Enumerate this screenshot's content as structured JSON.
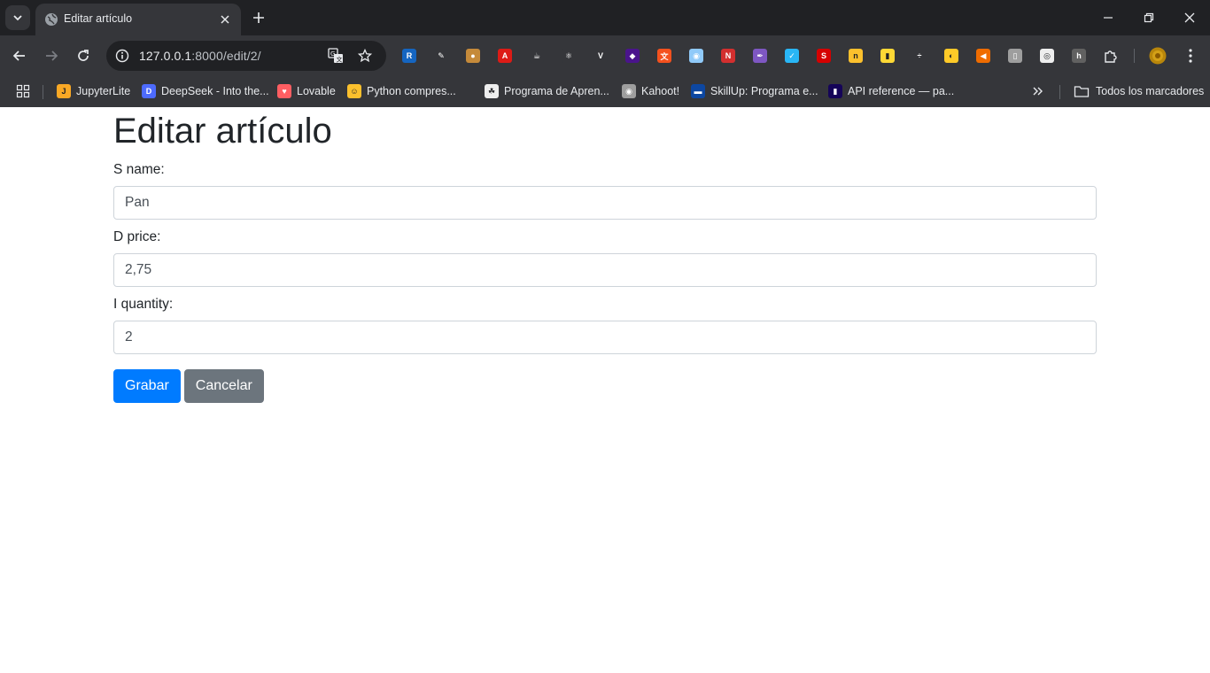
{
  "browser": {
    "tab": {
      "title": "Editar artículo"
    },
    "address": {
      "host": "127.0.0.1",
      "rest": ":8000/edit/2/"
    },
    "extensions": [
      {
        "icon": "react-dev-icon",
        "color": "#1565c0",
        "glyph": "R"
      },
      {
        "icon": "eyedropper-icon",
        "color": "#35363a",
        "glyph": "✎"
      },
      {
        "icon": "cookie-icon",
        "color": "#c58a3a",
        "glyph": "●"
      },
      {
        "icon": "angular-icon",
        "color": "#dd1b16",
        "glyph": "A"
      },
      {
        "icon": "java-icon",
        "color": "#35363a",
        "glyph": "☕"
      },
      {
        "icon": "react-icon",
        "color": "#35363a",
        "glyph": "⚛"
      },
      {
        "icon": "vue-icon",
        "color": "#35363a",
        "glyph": "V"
      },
      {
        "icon": "layers-icon",
        "color": "#4a148c",
        "glyph": "◆"
      },
      {
        "icon": "translate-ext-icon",
        "color": "#f4511e",
        "glyph": "文"
      },
      {
        "icon": "circle-ext-icon",
        "color": "#90caf9",
        "glyph": "◉"
      },
      {
        "icon": "new-ext-icon",
        "color": "#d32f2f",
        "glyph": "N"
      },
      {
        "icon": "feather-icon",
        "color": "#7e57c2",
        "glyph": "✒"
      },
      {
        "icon": "check-ext-icon",
        "color": "#29b6f6",
        "glyph": "✓"
      },
      {
        "icon": "s-ext-icon",
        "color": "#d50000",
        "glyph": "S"
      },
      {
        "icon": "n-ext-icon",
        "color": "#fbc02d",
        "glyph": "n"
      },
      {
        "icon": "bars-ext-icon",
        "color": "#fdd835",
        "glyph": "▮"
      },
      {
        "icon": "divider-ext-icon",
        "color": "#35363a",
        "glyph": "÷"
      },
      {
        "icon": "face-ext-icon",
        "color": "#ffca28",
        "glyph": "◐"
      },
      {
        "icon": "speaker-ext-icon",
        "color": "#ef6c00",
        "glyph": "◀"
      },
      {
        "icon": "mouse-ext-icon",
        "color": "#9e9e9e",
        "glyph": "▯"
      },
      {
        "icon": "doc-ext-icon",
        "color": "#eeeeee",
        "glyph": "◎"
      },
      {
        "icon": "h-ext-icon",
        "color": "#616161",
        "glyph": "h"
      }
    ],
    "bookmarks": [
      {
        "label": "JupyterLite",
        "icon": "jupyter-icon",
        "color": "#f9a825",
        "glyph": "J"
      },
      {
        "label": "DeepSeek - Into the...",
        "icon": "deepseek-icon",
        "color": "#4d6bfe",
        "glyph": "D"
      },
      {
        "label": "Lovable",
        "icon": "heart-icon",
        "color": "#ff5e62",
        "glyph": "♥"
      },
      {
        "label": "Python compres...",
        "icon": "python-icon",
        "color": "#fbc02d",
        "glyph": "☺"
      },
      {
        "label": "Programa de Apren...",
        "icon": "program-icon",
        "color": "#eeeeee",
        "glyph": "☘"
      },
      {
        "label": "Kahoot!",
        "icon": "kahoot-icon",
        "color": "#9e9e9e",
        "glyph": "◉"
      },
      {
        "label": "SkillUp: Programa e...",
        "icon": "skillup-icon",
        "color": "#0d47a1",
        "glyph": "▬"
      },
      {
        "label": "API reference — pa...",
        "icon": "pandas-icon",
        "color": "#150458",
        "glyph": "▮"
      }
    ],
    "all_bookmarks": "Todos los marcadores"
  },
  "page": {
    "title": "Editar artículo",
    "fields": [
      {
        "label": "S name:",
        "value": "Pan"
      },
      {
        "label": "D price:",
        "value": "2,75"
      },
      {
        "label": "I quantity:",
        "value": "2"
      }
    ],
    "save_label": "Grabar",
    "cancel_label": "Cancelar"
  }
}
